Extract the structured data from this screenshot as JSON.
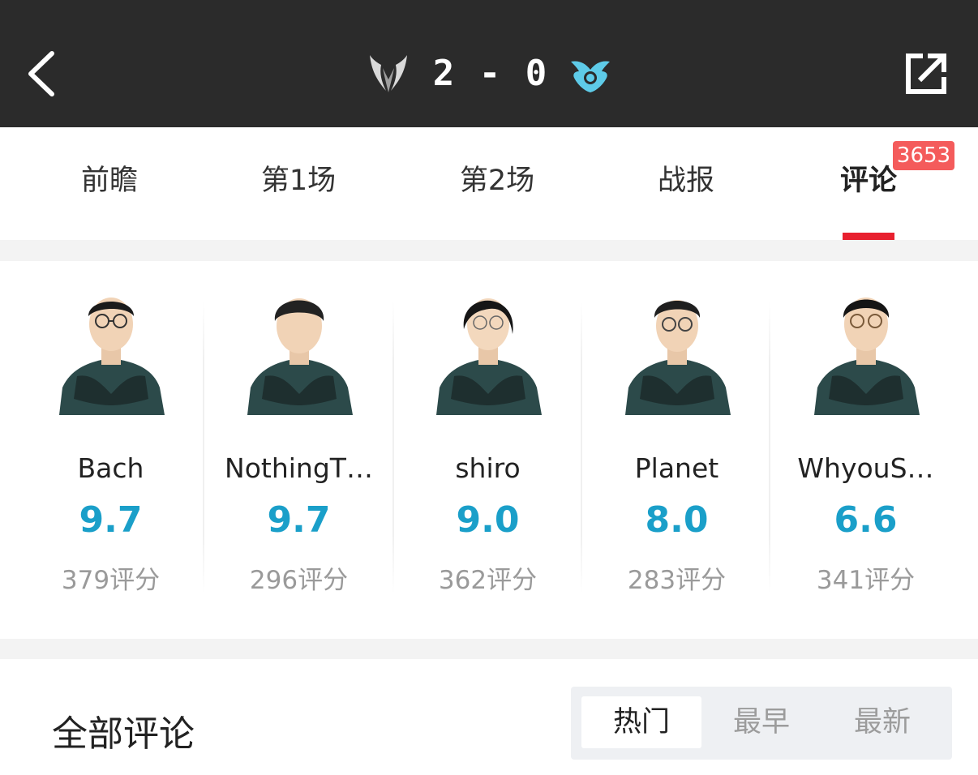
{
  "header": {
    "score": "2 - 0",
    "back_icon": "chevron-left-icon",
    "share_icon": "share-icon"
  },
  "tabs": [
    {
      "label": "前瞻"
    },
    {
      "label": "第1场"
    },
    {
      "label": "第2场"
    },
    {
      "label": "战报"
    },
    {
      "label": "评论",
      "active": true,
      "badge": "3653"
    }
  ],
  "players": [
    {
      "name": "Bach",
      "score": "9.7",
      "count": "379评分"
    },
    {
      "name": "NothingT…",
      "score": "9.7",
      "count": "296评分"
    },
    {
      "name": "shiro",
      "score": "9.0",
      "count": "362评分"
    },
    {
      "name": "Planet",
      "score": "8.0",
      "count": "283评分"
    },
    {
      "name": "WhyouS…",
      "score": "6.6",
      "count": "341评分"
    }
  ],
  "comments": {
    "title": "全部评论",
    "sort_options": [
      {
        "label": "热门",
        "active": true
      },
      {
        "label": "最早"
      },
      {
        "label": "最新"
      }
    ]
  },
  "colors": {
    "header_bg": "#2b2b2b",
    "accent_red": "#e8202f",
    "score_blue": "#1a9fc9",
    "badge_red": "#f45b5b"
  }
}
